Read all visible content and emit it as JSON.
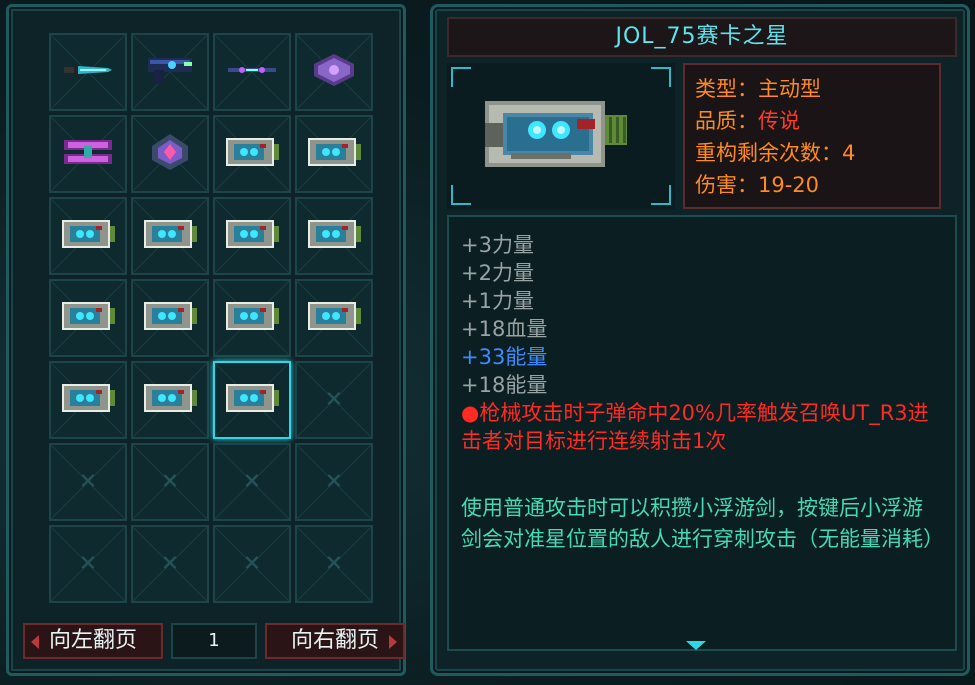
{
  "weapon": {
    "name": "JOL_75赛卡之星",
    "stats": [
      {
        "label": "类型：",
        "value": "主动型",
        "tone": "orange"
      },
      {
        "label": "品质：",
        "value": "传说",
        "tone": "red"
      },
      {
        "label": "重构剩余次数：",
        "value": "4",
        "tone": "orange"
      },
      {
        "label": "伤害：",
        "value": "19-20",
        "tone": "orange"
      }
    ],
    "attributes": [
      {
        "text": "+3力量",
        "tone": "grey"
      },
      {
        "text": "+2力量",
        "tone": "grey"
      },
      {
        "text": "+1力量",
        "tone": "grey"
      },
      {
        "text": "+18血量",
        "tone": "grey"
      },
      {
        "text": "+33能量",
        "tone": "blue"
      },
      {
        "text": "+18能量",
        "tone": "grey"
      }
    ],
    "effect": "●枪械攻击时子弹命中20%几率触发召唤UT_R3进击者对目标进行连续射击1次",
    "description": "使用普通攻击时可以积攒小浮游剑，按键后小浮游剑会对准星位置的敌人进行穿刺攻击（无能量消耗）"
  },
  "inventory": {
    "slots": [
      "dagger-icon",
      "pistol-icon",
      "laser-rifle-icon",
      "shield-drone-icon",
      "twin-blaster-icon",
      "crystal-core-icon",
      "cannon-icon",
      "cannon-icon",
      "cannon-icon",
      "cannon-icon",
      "cannon-icon",
      "cannon-icon",
      "cannon-icon",
      "cannon-icon",
      "cannon-icon",
      "cannon-icon",
      "cannon-icon",
      "cannon-icon",
      "cannon-icon",
      "empty",
      "empty",
      "empty",
      "empty",
      "empty",
      "empty",
      "empty",
      "empty",
      "empty"
    ],
    "selected_index": 18
  },
  "pager": {
    "prev_label": "向左翻页",
    "next_label": "向右翻页",
    "page": "1"
  },
  "colors": {
    "accent_cyan": "#2fd7e6",
    "stat_orange": "#ff8a1f",
    "legend_red": "#ff3b2a",
    "flavor_green": "#45d9b8",
    "attr_blue": "#3d8bff"
  }
}
